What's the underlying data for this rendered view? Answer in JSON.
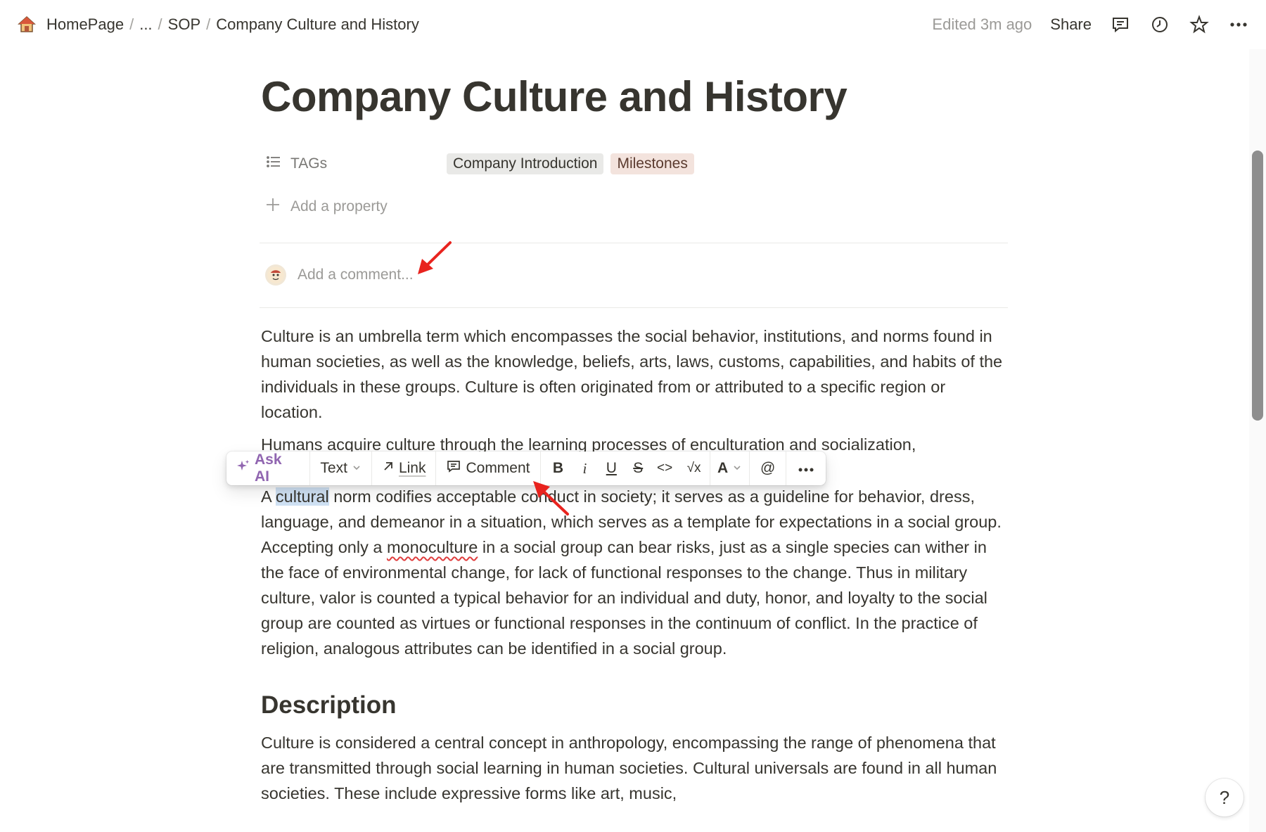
{
  "breadcrumb": {
    "home": "HomePage",
    "ellipsis": "...",
    "sop": "SOP",
    "current": "Company Culture and History",
    "separator": "/"
  },
  "topbar": {
    "edited": "Edited 3m ago",
    "share": "Share"
  },
  "page": {
    "title": "Company Culture and History",
    "property_name": "TAGs",
    "tags": [
      "Company Introduction",
      "Milestones"
    ],
    "add_property": "Add a property",
    "comment_placeholder": "Add a comment..."
  },
  "toolbar": {
    "ask_ai": "Ask AI",
    "text": "Text",
    "link": "Link",
    "comment": "Comment",
    "bold": "B",
    "italic": "i",
    "underline": "U",
    "strike": "S",
    "code": "<>",
    "math": "√x",
    "color": "A",
    "mention": "@",
    "more": "•••"
  },
  "content": {
    "p1": "Culture is an umbrella term which encompasses the social behavior, institutions, and norms found in human societies, as well as the knowledge, beliefs, arts, laws, customs, capabilities, and habits of the individuals in these groups. Culture is often originated from or attributed to a specific region or location.",
    "p2": "Humans acquire culture through the learning processes of enculturation and socialization,",
    "p3_a": "A ",
    "p3_hl": "cultural",
    "p3_b": " norm codifies acceptable conduct in society; it serves as a guideline for behavior, dress, language, and demeanor in a situation, which serves as a template for expectations in a social group. Accepting only a ",
    "p3_sq": "monoculture",
    "p3_c": " in a social group can bear risks, just as a single species can wither in the face of environmental change, for lack of functional responses to the change. Thus in military culture, valor is counted a typical behavior for an individual and duty, honor, and loyalty to the social group are counted as virtues or functional responses in the continuum of conflict. In the practice of religion, analogous attributes can be identified in a social group.",
    "h_description": "Description",
    "p4": "Culture is considered a central concept in anthropology, encompassing the range of phenomena that are transmitted through social learning in human societies. Cultural universals are found in all human societies. These include expressive forms like art, music,"
  },
  "help": "?",
  "colors": {
    "text": "#37352f",
    "muted": "#9b9a97",
    "ask_ai": "#9065b0",
    "tag_gray": "#e9e9e7",
    "tag_brown": "#f3e3dd",
    "selection": "#cfe1f4",
    "annotation_arrow": "#e8231e"
  }
}
